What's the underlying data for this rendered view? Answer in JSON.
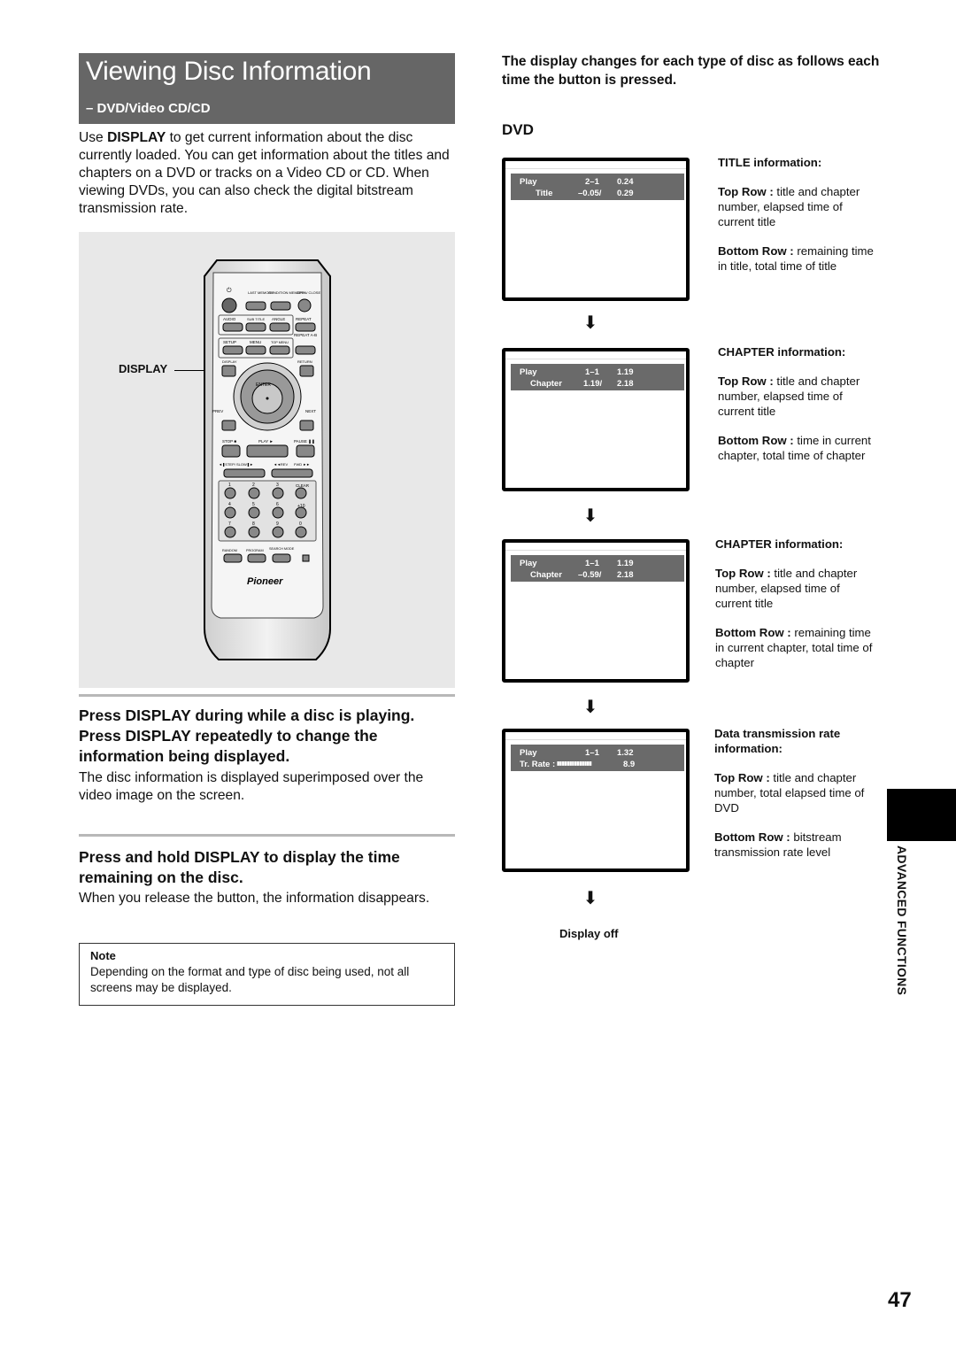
{
  "header": {
    "title": "Viewing Disc Information",
    "subtitle": "– DVD/Video CD/CD",
    "intro_prefix": "Use ",
    "intro_bold": "DISPLAY",
    "intro_rest": " to get current information about the disc currently loaded. You can get information about the titles and chapters on a DVD or tracks on a Video CD or CD. When viewing DVDs, you can also check the digital bitstream transmission rate."
  },
  "remote": {
    "callout": "DISPLAY",
    "labels": {
      "last_memory": "LAST MEMORY",
      "condition_memory": "CONDITION MEMORY",
      "open_close": "OPEN/ CLOSE",
      "audio": "AUDIO",
      "subtitle": "SUB TITLE",
      "angle": "ANGLE",
      "repeat": "REPEAT",
      "repeat_ab": "REPEAT A-B",
      "setup": "SETUP",
      "menu": "MENU",
      "top_menu": "TOP MENU",
      "display": "DISPLAY",
      "return": "RETURN",
      "enter": "ENTER",
      "prev": "PREV",
      "next": "NEXT",
      "stop": "STOP ■",
      "play": "PLAY ►",
      "pause": "PAUSE ❚❚",
      "step_slow": "◄❚STEP/ SLOW❚►",
      "rev": "◄◄REV",
      "fwd": "FWD ►►",
      "clear": "CLEAR",
      "plus10": "+10",
      "random": "RANDOM",
      "program": "PROGRAM",
      "search_mode": "SEARCH MODE",
      "brand": "Pioneer",
      "digits": [
        "1",
        "2",
        "3",
        "4",
        "5",
        "6",
        "7",
        "8",
        "9",
        "0"
      ]
    }
  },
  "steps": [
    {
      "heading": "Press DISPLAY during while a disc is playing. Press DISPLAY repeatedly to change the information being displayed.",
      "body": "The disc information is displayed superimposed over the video image on the screen."
    },
    {
      "heading": "Press and hold DISPLAY to display the time remaining on the disc.",
      "body": "When you release the button, the information disappears."
    }
  ],
  "note": {
    "label": "Note",
    "text": "Depending on the format and type of disc being used, not all screens may be displayed."
  },
  "right": {
    "intro": "The display changes for each type of disc as follows each time the button is pressed.",
    "section": "DVD",
    "screens": [
      {
        "row1_label": "Play",
        "row1_a": "2–1",
        "row1_b": "0.24",
        "row2_label": "Title",
        "row2_a": "–0.05/",
        "row2_b": "0.29",
        "info_title": "TITLE information:",
        "top_label": "Top Row :",
        "top_text": " title and chapter number, elapsed time of current title",
        "bottom_label": "Bottom Row :",
        "bottom_text": " remaining time in title, total time of title"
      },
      {
        "row1_label": "Play",
        "row1_a": "1–1",
        "row1_b": "1.19",
        "row2_label": "Chapter",
        "row2_a": "1.19/",
        "row2_b": "2.18",
        "info_title": "CHAPTER information:",
        "top_label": "Top Row :",
        "top_text": " title and chapter number, elapsed time of current title",
        "bottom_label": "Bottom Row :",
        "bottom_text": " time in current chapter, total time of chapter"
      },
      {
        "row1_label": "Play",
        "row1_a": "1–1",
        "row1_b": "1.19",
        "row2_label": "Chapter",
        "row2_a": "–0.59/",
        "row2_b": "2.18",
        "info_title": "CHAPTER information:",
        "top_label": "Top Row :",
        "top_text": " title and chapter number, elapsed time of current title",
        "bottom_label": "Bottom Row :",
        "bottom_text": " remaining time in current chapter, total time of chapter"
      },
      {
        "row1_label": "Play",
        "row1_a": "1–1",
        "row1_b": "1.32",
        "row2_label": "Tr. Rate  :",
        "row2_a": "▮▮▮▮▮▮▮▮▮▮▮▮▮▮",
        "row2_b": "8.9",
        "info_title": "Data transmission rate information:",
        "top_label": "Top Row :",
        "top_text": " title and chapter number, total elapsed time of DVD",
        "bottom_label": "Bottom Row :",
        "bottom_text": " bitstream transmission rate level"
      }
    ],
    "arrow_icon": "⬇",
    "display_off": "Display off"
  },
  "side_tab": {
    "label": "ADVANCED  FUNCTIONS"
  },
  "page_number": "47"
}
